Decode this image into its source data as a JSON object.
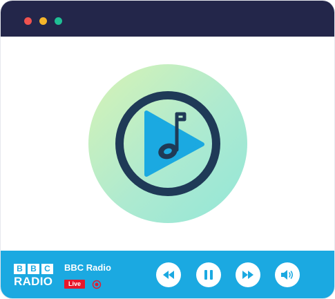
{
  "window": {
    "traffic_lights": [
      {
        "name": "close",
        "color": "#f0524f"
      },
      {
        "name": "minimize",
        "color": "#f5b52a"
      },
      {
        "name": "maximize",
        "color": "#1fbf95"
      }
    ],
    "titlebar_color": "#23264a"
  },
  "artwork": {
    "icon": "music-note-play-icon",
    "colors": {
      "gradient_start": "#d3f2b5",
      "gradient_end": "#9be7d4",
      "ring": "#1f3a57",
      "play": "#1ba9e1"
    }
  },
  "player": {
    "background_color": "#1ba9e1",
    "logo": {
      "blocks": [
        "B",
        "B",
        "C"
      ],
      "word": "RADIO"
    },
    "station_name": "BBC Radio",
    "live_label": "Live",
    "controls": [
      {
        "name": "rewind",
        "icon": "rewind-icon"
      },
      {
        "name": "pause",
        "icon": "pause-icon"
      },
      {
        "name": "forward",
        "icon": "fast-forward-icon"
      },
      {
        "name": "volume",
        "icon": "volume-icon"
      }
    ],
    "accent_color": "#e8172b"
  }
}
